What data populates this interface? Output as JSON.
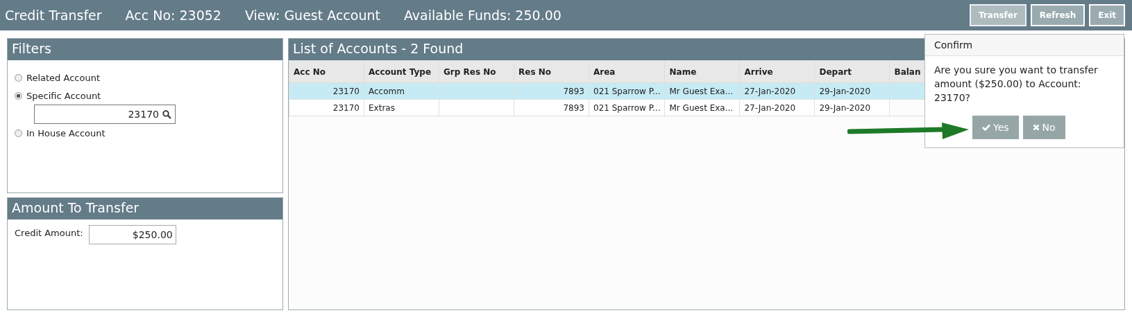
{
  "header": {
    "title": "Credit Transfer",
    "info": [
      "Acc No: 23052",
      "View: Guest Account",
      "Available Funds: 250.00"
    ],
    "buttons": [
      {
        "label": "Transfer",
        "selected": true
      },
      {
        "label": "Refresh",
        "selected": false
      },
      {
        "label": "Exit",
        "selected": false
      }
    ]
  },
  "filters": {
    "title": "Filters",
    "options": [
      {
        "label": "Related Account",
        "selected": false
      },
      {
        "label": "Specific Account",
        "selected": true
      },
      {
        "label": "In House Account",
        "selected": false
      }
    ],
    "account_value": "23170"
  },
  "amount": {
    "title": "Amount To Transfer",
    "label": "Credit Amount:",
    "value": "$250.00"
  },
  "accounts": {
    "title": "List of Accounts - 2 Found",
    "columns": [
      "Acc No",
      "Account Type",
      "Grp Res No",
      "Res No",
      "Area",
      "Name",
      "Arrive",
      "Depart",
      "Balan"
    ],
    "rows": [
      {
        "selected": true,
        "cells": [
          "23170",
          "Accomm",
          "",
          "7893",
          "021 Sparrow P...",
          "Mr Guest Exa...",
          "27-Jan-2020",
          "29-Jan-2020"
        ]
      },
      {
        "selected": false,
        "cells": [
          "23170",
          "Extras",
          "",
          "7893",
          "021 Sparrow P...",
          "Mr Guest Exa...",
          "27-Jan-2020",
          "29-Jan-2020"
        ]
      }
    ]
  },
  "confirm": {
    "title": "Confirm",
    "message": "Are you sure you want to transfer amount ($250.00) to Account: 23170?",
    "buttons": [
      {
        "kind": "yes",
        "label": "Yes"
      },
      {
        "kind": "no",
        "label": "No"
      }
    ]
  }
}
